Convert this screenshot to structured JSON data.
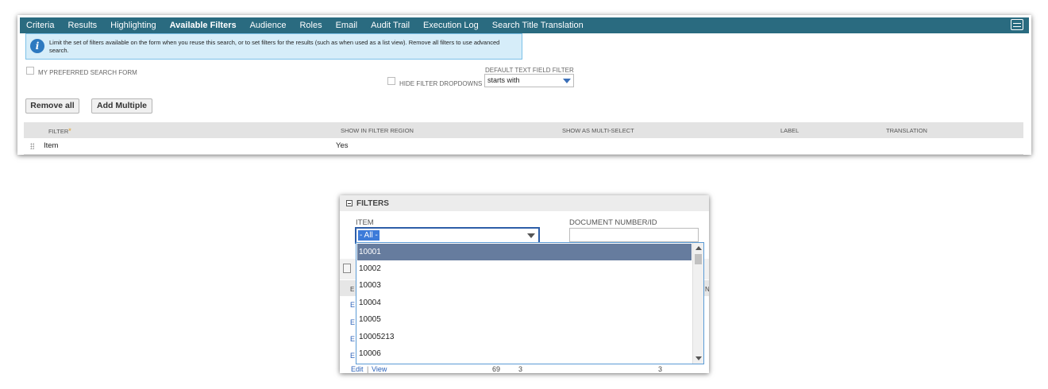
{
  "tabs": [
    {
      "label": "Criteria",
      "active": false
    },
    {
      "label": "Results",
      "active": false
    },
    {
      "label": "Highlighting",
      "active": false
    },
    {
      "label": "Available Filters",
      "active": true
    },
    {
      "label": "Audience",
      "active": false
    },
    {
      "label": "Roles",
      "active": false
    },
    {
      "label": "Email",
      "active": false
    },
    {
      "label": "Audit Trail",
      "active": false
    },
    {
      "label": "Execution Log",
      "active": false
    },
    {
      "label": "Search Title Translation",
      "active": false
    }
  ],
  "info_text": "Limit the set of filters available on the form when you reuse this search, or to set filters for the results (such as when used as a list view). Remove all filters to use advanced search.",
  "form": {
    "preferred_label": "MY PREFERRED SEARCH FORM",
    "hide_dropdowns_label": "HIDE FILTER DROPDOWNS",
    "default_filter_label": "DEFAULT TEXT FIELD FILTER",
    "default_filter_value": "starts with"
  },
  "buttons": {
    "remove_all": "Remove all",
    "add_multiple": "Add Multiple"
  },
  "table": {
    "headers": [
      "FILTER",
      "SHOW IN FILTER REGION",
      "SHOW AS MULTI-SELECT",
      "LABEL",
      "TRANSLATION"
    ],
    "required_mark": "*",
    "rows": [
      {
        "filter": "Item",
        "show_in_region": "Yes"
      }
    ]
  },
  "filters_panel": {
    "title": "FILTERS",
    "item_label": "ITEM",
    "item_value": "- All -",
    "doc_label": "DOCUMENT NUMBER/ID",
    "options": [
      "10001",
      "10002",
      "10003",
      "10004",
      "10005",
      "10005213",
      "10006"
    ],
    "selected_index": 0,
    "behind": {
      "col_e": "E",
      "col_n": "N",
      "edit": "Edit",
      "sep": "|",
      "view": "View",
      "num1": "69",
      "num2": "3",
      "num3": "3"
    }
  },
  "colors": {
    "tabbar": "#2a6b80",
    "info_bg": "#d6edf9",
    "selected_option": "#667c9e",
    "link": "#2b62b8"
  }
}
